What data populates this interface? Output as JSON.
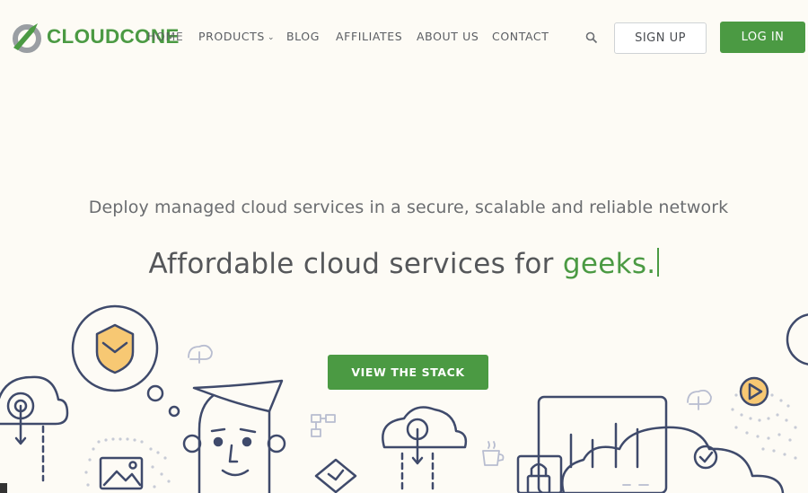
{
  "brand": {
    "name_part1": "CLOUD",
    "name_part2": "CONE"
  },
  "nav": {
    "home": "HOME",
    "products": "PRODUCTS",
    "blog": "BLOG",
    "affiliates": "AFFILIATES",
    "about": "ABOUT US",
    "contact": "CONTACT"
  },
  "actions": {
    "signup": "SIGN UP",
    "login": "LOG IN"
  },
  "hero": {
    "tagline": "Deploy managed cloud services in a secure, scalable and reliable network",
    "headline_prefix": "Affordable cloud services for ",
    "headline_accent": "geeks.",
    "cta": "VIEW THE STACK"
  },
  "colors": {
    "brand_green": "#4b9a43",
    "background": "#fdfbf5",
    "line_art": "#3f4a6b",
    "highlight": "#f7c873"
  }
}
